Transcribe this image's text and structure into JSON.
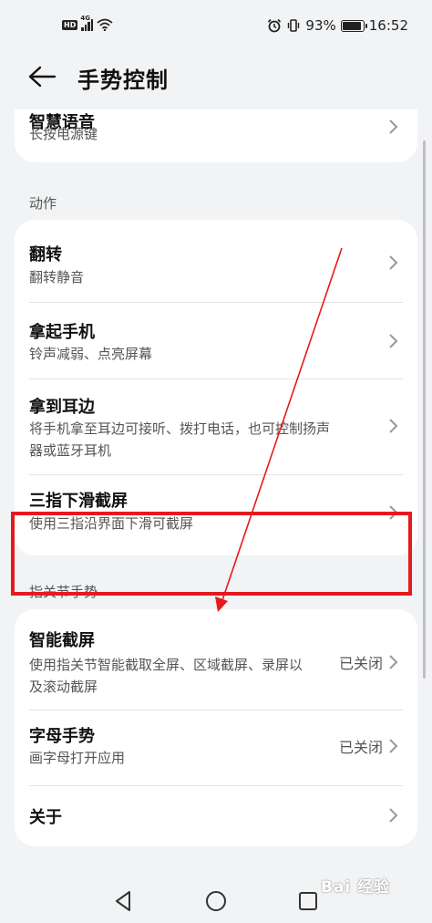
{
  "status_bar": {
    "hd": "HD",
    "network": "4G",
    "battery": "93%",
    "battery_level": 0.93,
    "time": "16:52"
  },
  "header": {
    "title": "手势控制"
  },
  "partial_row": {
    "title": "智慧语音",
    "subtitle": "长按电源键"
  },
  "sections": {
    "actions": "动作",
    "knuckle": "指关节手势"
  },
  "action_items": [
    {
      "title": "翻转",
      "subtitle": "翻转静音"
    },
    {
      "title": "拿起手机",
      "subtitle": "铃声减弱、点亮屏幕"
    },
    {
      "title": "拿到耳边",
      "subtitle": "将手机拿至耳边可接听、拨打电话，也可控制扬声器或蓝牙耳机"
    },
    {
      "title": "三指下滑截屏",
      "subtitle": "使用三指沿界面下滑可截屏"
    }
  ],
  "knuckle_items": [
    {
      "title": "智能截屏",
      "subtitle": "使用指关节智能截取全屏、区域截屏、录屏以及滚动截屏",
      "value": "已关闭"
    },
    {
      "title": "字母手势",
      "subtitle": "画字母打开应用",
      "value": "已关闭"
    },
    {
      "title": "关于"
    }
  ],
  "watermark": "Bai 经验",
  "colors": {
    "highlight": "#e6191e",
    "background": "#f1f3f5",
    "card": "#ffffff"
  },
  "icons": {
    "back": "arrow-left-icon",
    "chevron": "chevron-right-icon",
    "nav_back": "triangle-back-icon",
    "nav_home": "circle-home-icon",
    "nav_recent": "square-recent-icon"
  }
}
